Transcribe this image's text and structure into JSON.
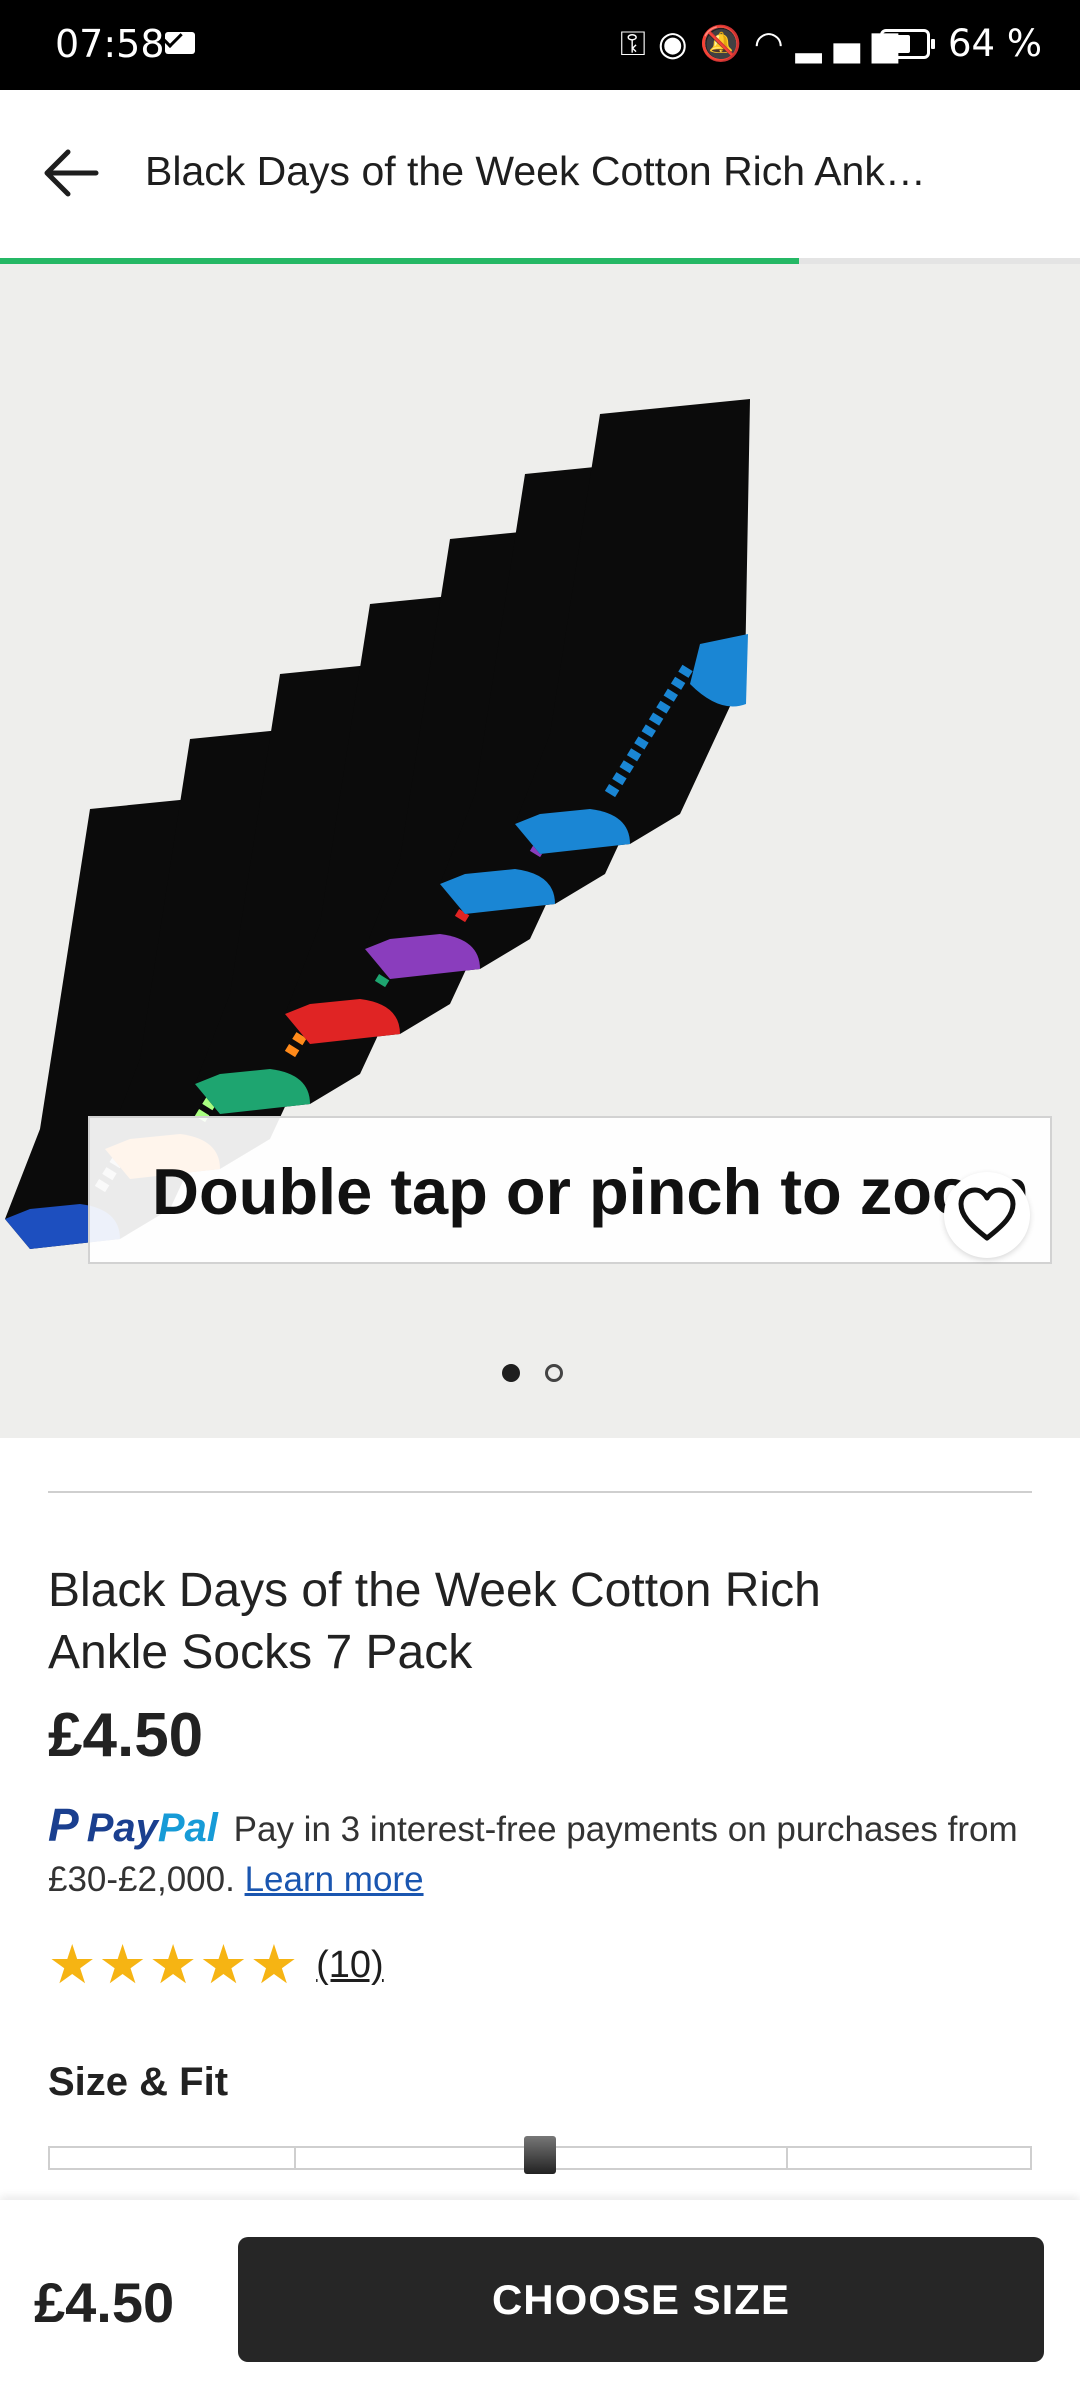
{
  "status_bar": {
    "time": "07:58",
    "battery_percent": "64 %",
    "battery_level": 0.64,
    "icons": [
      "mail-icon",
      "key-icon",
      "eye-icon",
      "bell-off-icon",
      "wifi-icon",
      "signal-icon",
      "battery-icon"
    ]
  },
  "app_bar": {
    "title": "Black Days of the Week Cotton Rich Ank…",
    "back_icon": "arrow-left-icon"
  },
  "progress": {
    "fraction": 0.74,
    "color": "#25b865"
  },
  "gallery": {
    "zoom_hint": "Double tap or pinch to zoom",
    "page_index": 1,
    "page_count": 2,
    "wishlist_icon": "heart-outline-icon"
  },
  "product": {
    "name": "Black Days of the Week Cotton Rich Ankle Socks 7 Pack",
    "price": "£4.50",
    "paypal": {
      "brand_pay": "Pay",
      "brand_pal": "Pal",
      "text": "Pay in 3 interest-free payments on purchases from £30-£2,000.",
      "link": "Learn more"
    },
    "rating": {
      "stars": 5,
      "count": "(10)",
      "color": "#f6b413"
    },
    "size_fit": {
      "label": "Size & Fit",
      "value_fraction": 0.5
    }
  },
  "bottom_bar": {
    "price": "£4.50",
    "button": "CHOOSE SIZE"
  }
}
